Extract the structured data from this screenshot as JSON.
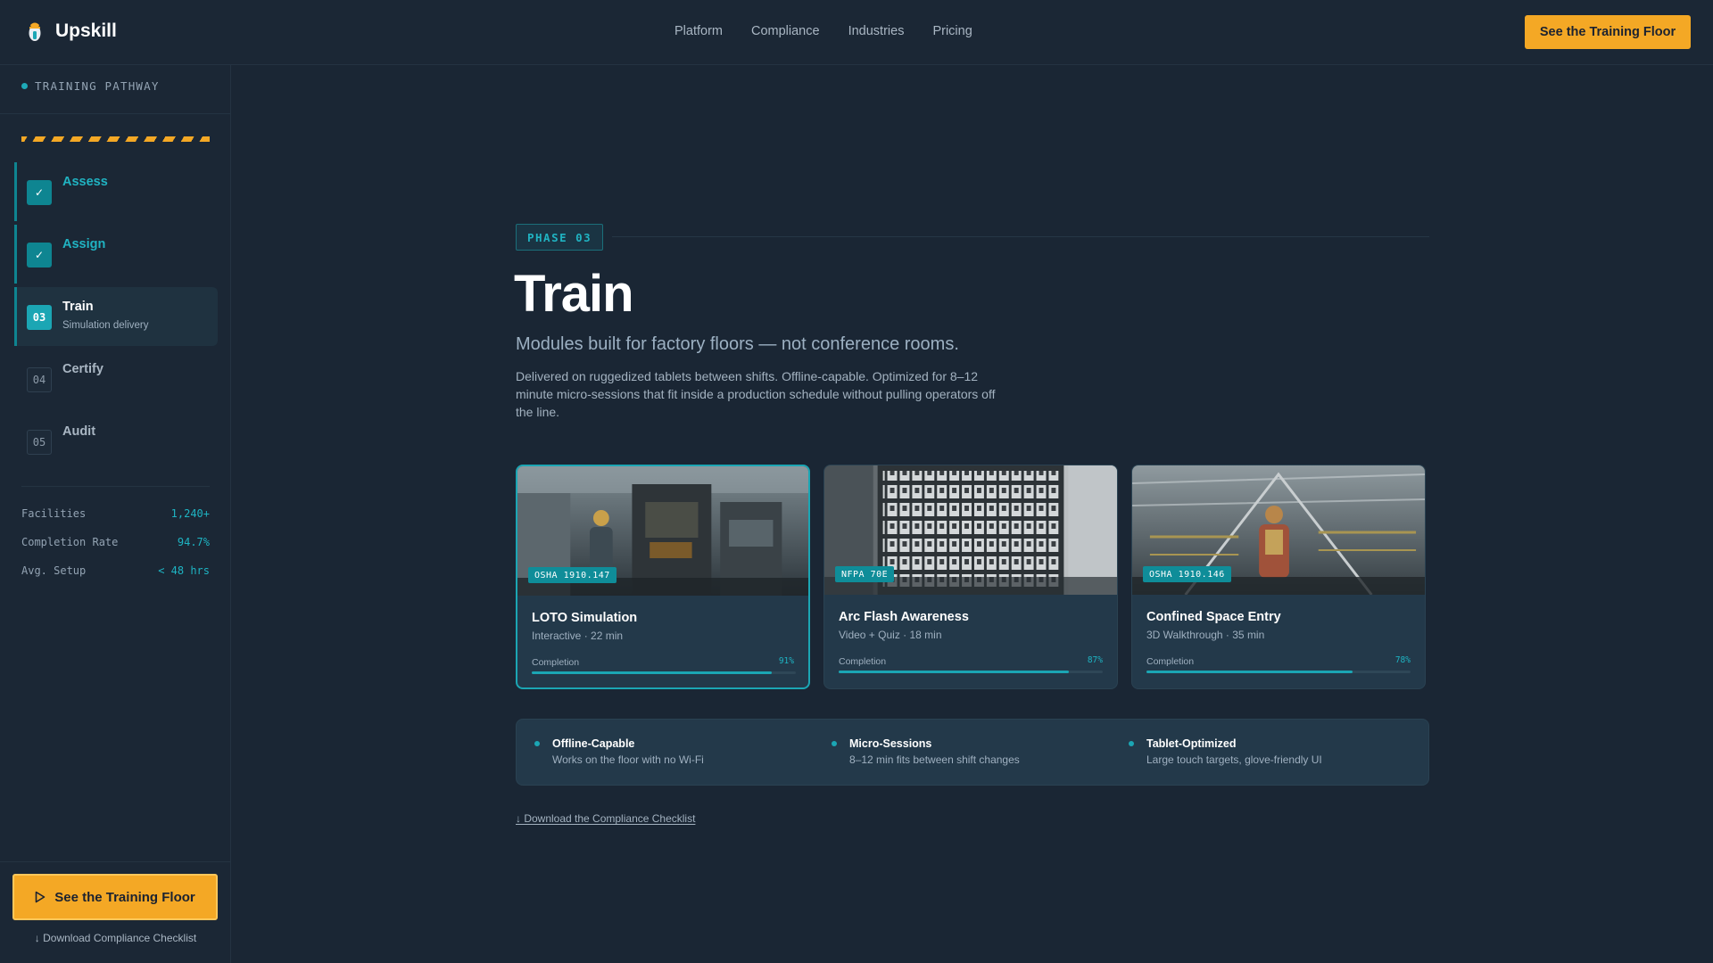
{
  "brand": {
    "name": "Upskill"
  },
  "nav": {
    "items": [
      "Platform",
      "Compliance",
      "Industries",
      "Pricing"
    ]
  },
  "header": {
    "cta_label": "See the Training Floor"
  },
  "sidebar": {
    "heading": "TRAINING PATHWAY",
    "steps": [
      {
        "badge": "✓",
        "label": "Assess",
        "state": "done"
      },
      {
        "badge": "✓",
        "label": "Assign",
        "state": "done"
      },
      {
        "badge": "03",
        "label": "Train",
        "sublabel": "Simulation delivery",
        "state": "active"
      },
      {
        "badge": "04",
        "label": "Certify",
        "state": "todo"
      },
      {
        "badge": "05",
        "label": "Audit",
        "state": "todo"
      }
    ],
    "stats": [
      {
        "label": "Facilities",
        "value": "1,240+"
      },
      {
        "label": "Completion Rate",
        "value": "94.7%"
      },
      {
        "label": "Avg. Setup",
        "value": "< 48 hrs"
      }
    ],
    "cta_label": "See the Training Floor",
    "download_link": "↓ Download Compliance Checklist"
  },
  "main": {
    "phase_tag": "PHASE 03",
    "title": "Train",
    "subtitle": "Modules built for factory floors — not conference rooms.",
    "description": "Delivered on ruggedized tablets between shifts. Offline-capable. Optimized for 8–12 minute micro-sessions that fit inside a production schedule without pulling operators off the line.",
    "cards": [
      {
        "tag": "OSHA 1910.147",
        "title": "LOTO Simulation",
        "meta": "Interactive · 22 min",
        "completion_label": "Completion",
        "completion_pct": "91%",
        "completion": 91
      },
      {
        "tag": "NFPA 70E",
        "title": "Arc Flash Awareness",
        "meta": "Video + Quiz · 18 min",
        "completion_label": "Completion",
        "completion_pct": "87%",
        "completion": 87
      },
      {
        "tag": "OSHA 1910.146",
        "title": "Confined Space Entry",
        "meta": "3D Walkthrough · 35 min",
        "completion_label": "Completion",
        "completion_pct": "78%",
        "completion": 78
      }
    ],
    "features": [
      {
        "title": "Offline-Capable",
        "desc": "Works on the floor with no Wi-Fi"
      },
      {
        "title": "Micro-Sessions",
        "desc": "8–12 min fits between shift changes"
      },
      {
        "title": "Tablet-Optimized",
        "desc": "Large touch targets, glove-friendly UI"
      }
    ],
    "download_link": "↓ Download the Compliance Checklist"
  },
  "colors": {
    "accent": "#1ba6b4",
    "cta": "#f4a825",
    "background": "#1a2634"
  }
}
